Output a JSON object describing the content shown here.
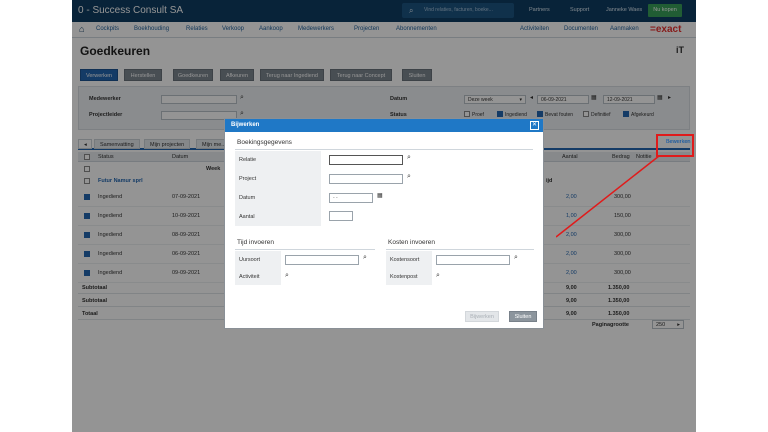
{
  "app": {
    "company": "0 - Success Consult SA",
    "search_placeholder": "Vind relaties, facturen, boeke...",
    "top_links": [
      "Partners",
      "Support",
      "Janneke Waes"
    ],
    "buy_label": "Nu kopen",
    "logo": "=exact"
  },
  "menu": {
    "items": [
      "Cockpits",
      "Boekhouding",
      "Relaties",
      "Verkoop",
      "Aankoop",
      "Medewerkers",
      "Projecten",
      "Abonnementen"
    ],
    "right_items": [
      "Activiteiten",
      "Documenten",
      "Aanmaken"
    ]
  },
  "page": {
    "title": "Goedkeuren",
    "it_label": "iT"
  },
  "toolbar": {
    "buttons": [
      "Verwerken",
      "Herstellen",
      "Goedkeuren",
      "Afkeuren",
      "Terug naar Ingediend",
      "Terug naar Concept",
      "Sluiten"
    ]
  },
  "filters": {
    "employee_label": "Medewerker",
    "project_leader_label": "Projectleider",
    "date_label": "Datum",
    "period_value": "Deze week",
    "date_from": "06-09-2021",
    "date_to": "12-09-2021",
    "status_label": "Status",
    "status_options": [
      {
        "label": "Proef",
        "checked": false
      },
      {
        "label": "Ingediend",
        "checked": true
      },
      {
        "label": "Bevat fouten",
        "checked": true
      },
      {
        "label": "Definitief",
        "checked": false
      },
      {
        "label": "Afgekeurd",
        "checked": true
      }
    ]
  },
  "tabs": [
    "Samenvatting",
    "Mijn projecten",
    "Mijn me..."
  ],
  "edit_link": "Bewerken",
  "grid": {
    "headers": [
      "Status",
      "Datum",
      "Aantal",
      "Bedrag",
      "Notitie"
    ],
    "week_label": "Week",
    "group_label": "Futur Namur sprl",
    "extra_label": "ijd",
    "rows": [
      {
        "status": "Ingediend",
        "date": "07-09-2021",
        "qty": "2,00",
        "amount": "300,00"
      },
      {
        "status": "Ingediend",
        "date": "10-09-2021",
        "qty": "1,00",
        "amount": "150,00"
      },
      {
        "status": "Ingediend",
        "date": "08-09-2021",
        "qty": "2,00",
        "amount": "300,00"
      },
      {
        "status": "Ingediend",
        "date": "06-09-2021",
        "qty": "2,00",
        "amount": "300,00"
      },
      {
        "status": "Ingediend",
        "date": "09-09-2021",
        "qty": "2,00",
        "amount": "300,00"
      }
    ],
    "subtotals": [
      {
        "label": "Subtotaal",
        "qty": "9,00",
        "amount": "1.350,00"
      },
      {
        "label": "Subtotaal",
        "qty": "9,00",
        "amount": "1.350,00"
      },
      {
        "label": "Totaal",
        "qty": "9,00",
        "amount": "1.350,00"
      }
    ],
    "page_size_label": "Paginagrootte",
    "page_size_value": "250"
  },
  "modal": {
    "title": "Bijwerken",
    "close_symbol": "✕",
    "section_booking": "Boekingsgegevens",
    "relation_label": "Relatie",
    "project_label": "Project",
    "date_label": "Datum",
    "date_placeholder": "- -",
    "quantity_label": "Aantal",
    "section_time": "Tijd invoeren",
    "hour_type_label": "Uursoort",
    "activity_label": "Activiteit",
    "section_costs": "Kosten invoeren",
    "cost_type_label": "Kostensoort",
    "cost_item_label": "Kostenpost",
    "update_button": "Bijwerken",
    "close_button": "Sluiten"
  },
  "colors": {
    "topbar": "#0f3d63",
    "accent": "#2467b0",
    "modal_header": "#1f78c6",
    "annotation": "#e01b1b",
    "logo": "#e8312f"
  }
}
